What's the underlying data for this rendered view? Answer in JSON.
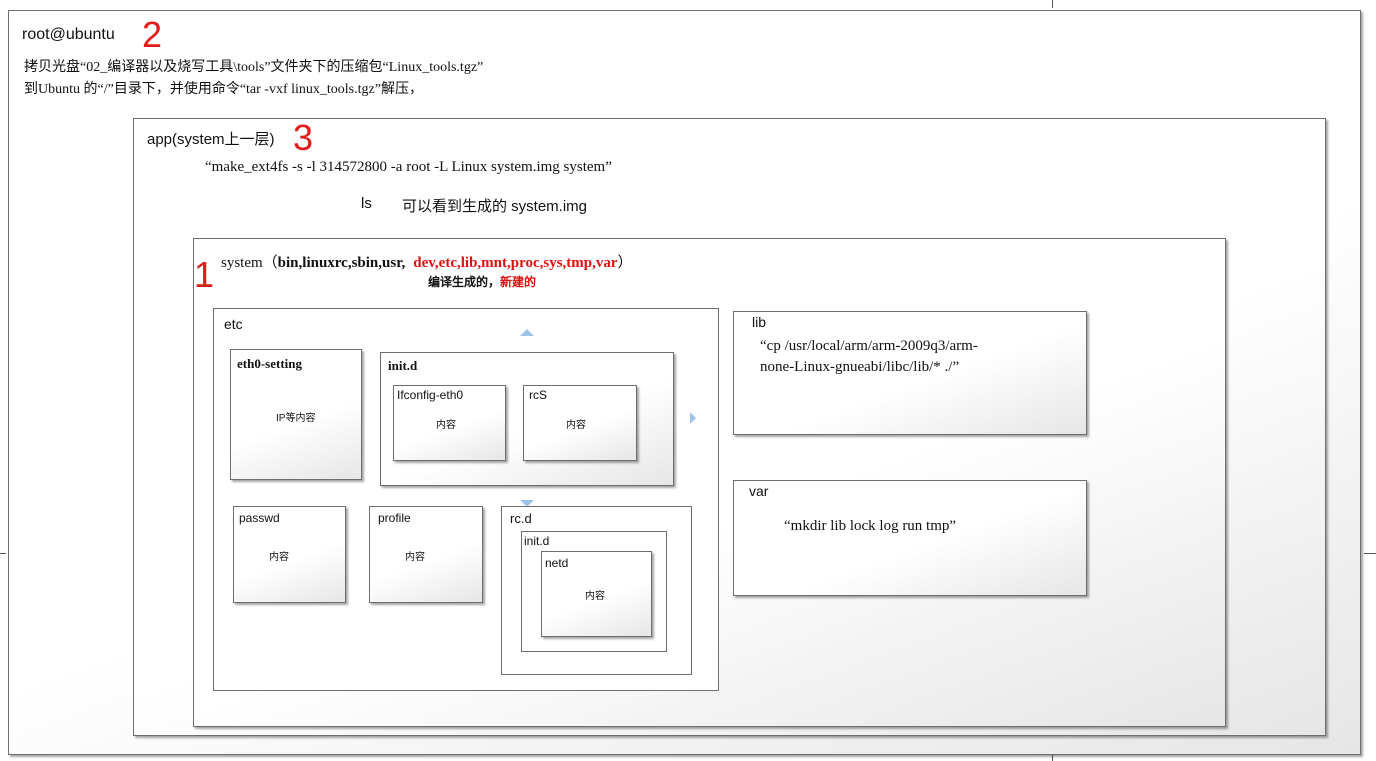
{
  "outer": {
    "title": "root@ubuntu",
    "step": "2",
    "line1": "拷贝光盘“02_编译器以及烧写工具\\tools”文件夹下的压缩包“Linux_tools.tgz”",
    "line2": "到Ubuntu 的“/”目录下，并使用命令“tar -vxf linux_tools.tgz”解压，"
  },
  "app": {
    "title": "app(system上一层)",
    "step": "3",
    "command": "“make_ext4fs -s -l 314572800 -a root -L Linux system.img system”",
    "ls_label": "ls",
    "ls_desc": "可以看到生成的 system.img"
  },
  "system": {
    "step": "1",
    "prefix": "system（",
    "compiled": "bin,linuxrc,sbin,usr,",
    "created": "dev,etc,lib,mnt,proc,sys,tmp,var",
    "suffix": "）",
    "note_compiled": "编译生成的，",
    "note_created": "新建的"
  },
  "etc": {
    "label": "etc",
    "eth0": {
      "title": "eth0-setting",
      "content": "IP等内容"
    },
    "initd": {
      "title": "init.d",
      "ifconfig": {
        "title": "Ifconfig-eth0",
        "content": "内容"
      },
      "rcs": {
        "title": "rcS",
        "content": "内容"
      }
    },
    "passwd": {
      "title": "passwd",
      "content": "内容"
    },
    "profile": {
      "title": "profile",
      "content": "内容"
    },
    "rcd": {
      "title": "rc.d",
      "initd": {
        "title": "init.d",
        "netd": {
          "title": "netd",
          "content": "内容"
        }
      }
    }
  },
  "lib": {
    "label": "lib",
    "command_line1": "“cp /usr/local/arm/arm-2009q3/arm-",
    "command_line2": "none-Linux-gnueabi/libc/lib/* ./”"
  },
  "var": {
    "label": "var",
    "command": "“mkdir lib lock log run tmp”"
  },
  "colors": {
    "step_number": "#e21a1a",
    "created_dirs": "#e01010",
    "arrow": "#9cc3e6",
    "border": "#6e6e6e"
  }
}
